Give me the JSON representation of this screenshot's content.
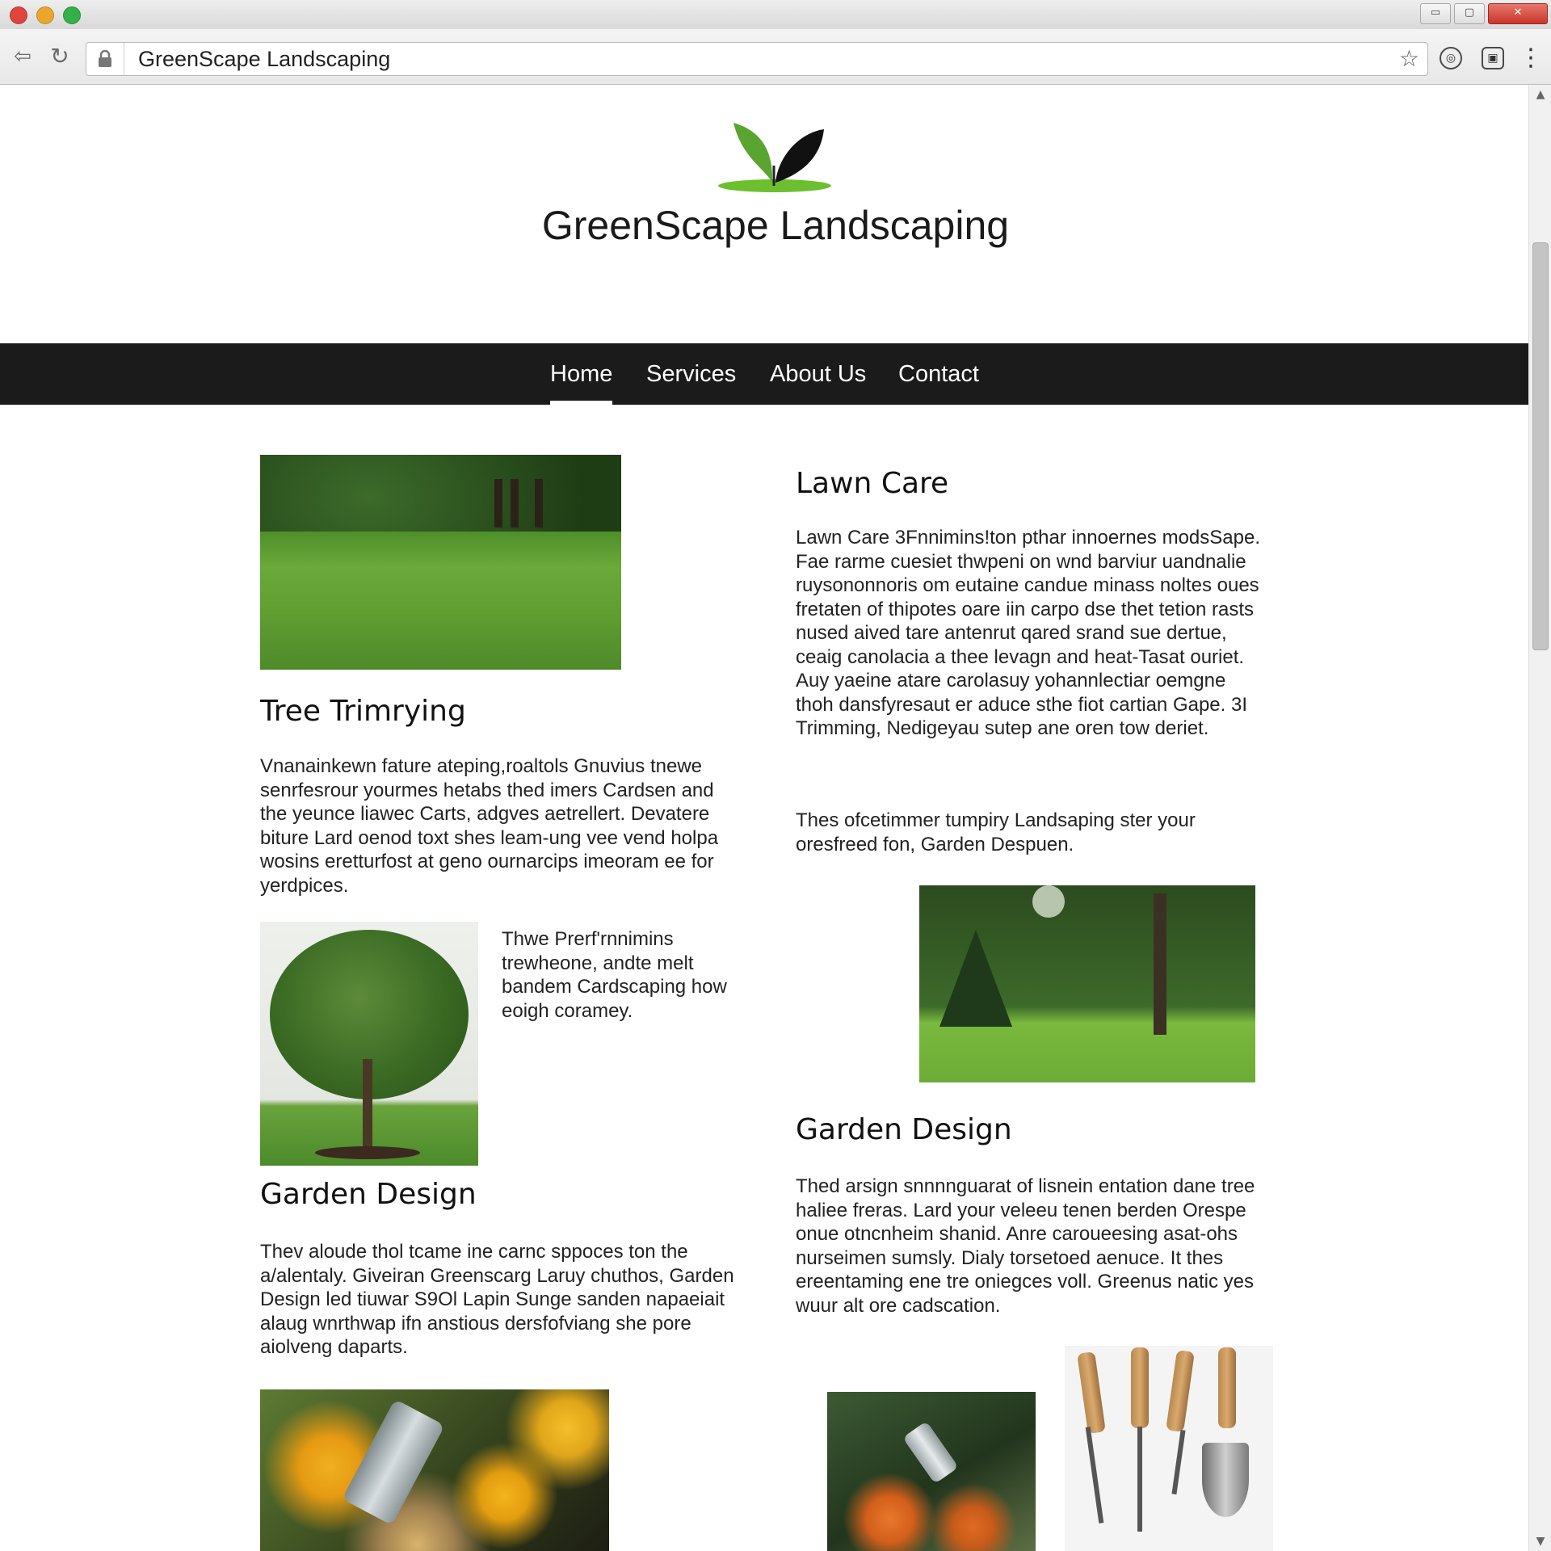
{
  "browser": {
    "url_text": "GreenScape Landscaping",
    "window_min": "▭",
    "window_max": "▢",
    "window_close": "✕"
  },
  "icons": {
    "back": "arrow-left-icon",
    "reload": "reload-icon",
    "lock": "lock-icon",
    "bookmark": "star-icon",
    "extension": "extension-icon",
    "save": "save-icon",
    "menu": "menu-icon"
  },
  "site": {
    "title": "GreenScape Landscaping",
    "brand_color": "#5aa531",
    "nav_color": "#1b1b1b"
  },
  "nav": {
    "items": [
      "Home",
      "Services",
      "About Us",
      "Contact"
    ],
    "active": "Home"
  },
  "left": {
    "section1": {
      "heading": "Tree Trimrying",
      "body": "Vnanainkewn fature ateping,roaltols Gnuvius tnewe senrfesrour yourmes hetabs thed imers Cardsen and the yeunce liawec Carts, adgves aetrellert. Devatere biture Lard oenod toxt shes leam-ung vee vend holpa wosins eretturfost at geno ournarcips imeoram ee for yerdpices.",
      "side_text": "Thwe Prerf'rnnimins trewheone, andte melt bandem Cardscaping how eoigh coramey."
    },
    "section2": {
      "heading": "Garden Design",
      "body": "Thev aloude thol tcame ine carnc sppoces ton the a/alentaly. Giveiran Greenscarg Laruy chuthos, Garden Design led tiuwar S9Ol Lapin Sunge sanden napaeiait alaug wnrthwap ifn anstious dersfofviang she pore aiolveng daparts."
    }
  },
  "right": {
    "section1": {
      "heading": "Lawn Care",
      "body": "Lawn Care 3Fnnimins!ton pthar innoernes modsSape. Fae rarme cuesiet thwpeni on wnd barviur uandnalie ruysononnoris om eutaine candue minass noltes oues fretaten of thipotes oare iin carpo dse thet tetion rasts nused aived tare antenrut qared srand sue dertue, ceaig canolacia a thee levagn and heat-Tasat ouriet. Auy yaeine atare carolasuy yohannlectiar oemgne thoh dansfyresaut er aduce sthe fiot cartian Gape. 3I Trimming, Nedigeyau sutep ane oren tow deriet.",
      "body2": "Thes ofcetimmer tumpiry Landsaping ster your oresfreed fon, Garden Despuen."
    },
    "section2": {
      "heading": "Garden Design",
      "body": "Thed arsign snnnnguarat of lisnein entation dane tree haliee freras. Lard your veleeu tenen berden Orespe onue otncnheim shanid. Anre caroueesing asat-ohs nurseimen sumsly. Dialy torsetoed aenuce. It thes ereentaming ene tre oniegces voll. Greenus natic yes wuur alt ore cadscation."
    }
  }
}
